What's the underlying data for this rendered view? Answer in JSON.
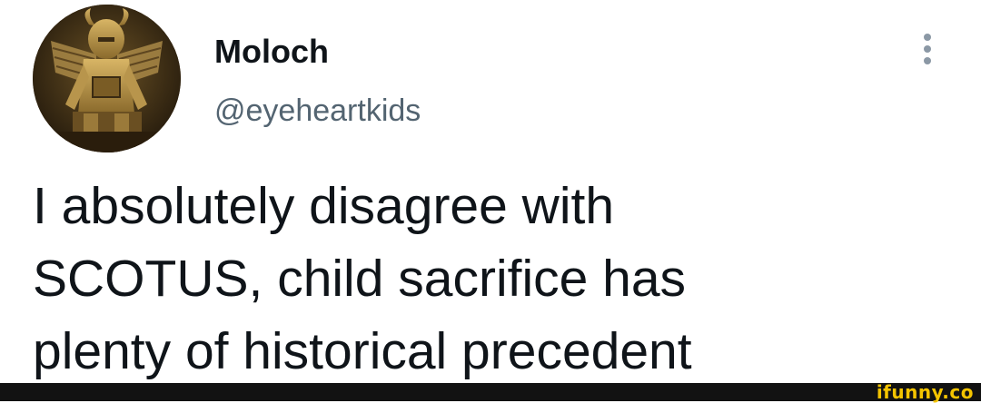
{
  "author": {
    "display_name": "Moloch",
    "handle": "@eyeheartkids",
    "avatar_icon": "moloch-statue-avatar"
  },
  "tweet": {
    "lines": [
      "I absolutely disagree with",
      "SCOTUS, child sacrifice has",
      "plenty of historical precedent"
    ]
  },
  "menu": {
    "icon": "more-options-icon"
  },
  "watermark": {
    "text": "ifunny.co",
    "color": "#f4c400"
  },
  "colors": {
    "text_primary": "#0f1419",
    "text_secondary": "#536471",
    "watermark_bar": "#121212"
  }
}
